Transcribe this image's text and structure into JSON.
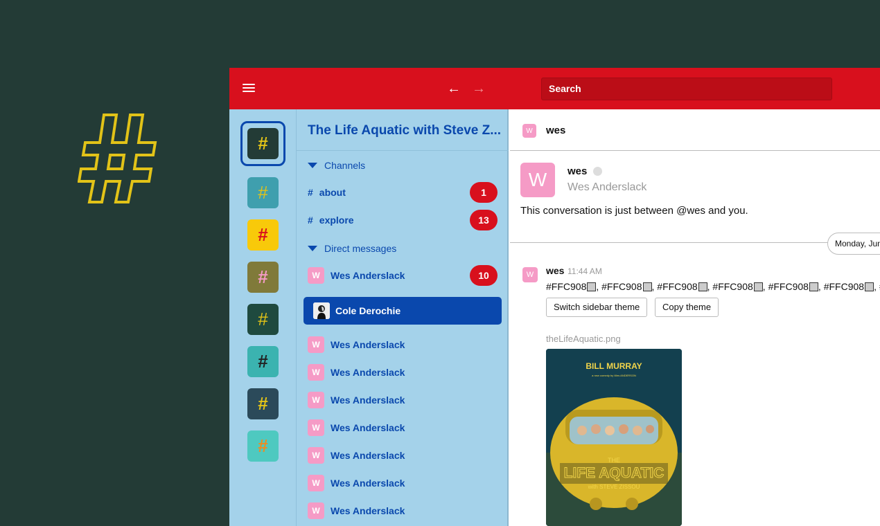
{
  "brand": {
    "logo_icon": "hash-icon",
    "logo_color": "#e2c318"
  },
  "topbar": {
    "menu_icon": "hamburger-icon",
    "back_icon": "arrow-left-icon",
    "forward_icon": "arrow-right-icon",
    "back_glyph": "←",
    "forward_glyph": "→",
    "search_label": "Search",
    "color": "#d8101d"
  },
  "workspaces": [
    {
      "name": "workspace-1",
      "icon": "hash-icon",
      "selected": true
    },
    {
      "name": "workspace-2",
      "icon": "hash-icon"
    },
    {
      "name": "workspace-3",
      "icon": "hash-icon"
    },
    {
      "name": "workspace-4",
      "icon": "hash-icon"
    },
    {
      "name": "workspace-5",
      "icon": "hash-icon"
    },
    {
      "name": "workspace-6",
      "icon": "hash-icon"
    },
    {
      "name": "workspace-7",
      "icon": "hash-icon"
    },
    {
      "name": "workspace-8",
      "icon": "hash-icon"
    }
  ],
  "sidebar": {
    "team_name": "The Life Aquatic with Steve Z...",
    "channels_header": "Channels",
    "channels": [
      {
        "hash": "#",
        "name": "about",
        "badge": "1"
      },
      {
        "hash": "#",
        "name": "explore",
        "badge": "13"
      }
    ],
    "dm_header": "Direct messages",
    "dms": [
      {
        "avatar": "W",
        "name": "Wes Anderslack",
        "badge": "10"
      },
      {
        "avatar": "",
        "name": "Cole Derochie",
        "active": true
      },
      {
        "avatar": "W",
        "name": "Wes Anderslack"
      },
      {
        "avatar": "W",
        "name": "Wes Anderslack"
      },
      {
        "avatar": "W",
        "name": "Wes Anderslack"
      },
      {
        "avatar": "W",
        "name": "Wes Anderslack"
      },
      {
        "avatar": "W",
        "name": "Wes Anderslack"
      },
      {
        "avatar": "W",
        "name": "Wes Anderslack"
      },
      {
        "avatar": "W",
        "name": "Wes Anderslack"
      }
    ]
  },
  "conversation": {
    "avatar": "W",
    "title": "wes",
    "intro": {
      "avatar": "W",
      "name": "wes",
      "full_name": "Wes Anderslack",
      "text": "This conversation is just between @wes and you."
    },
    "date_divider": "Monday, June",
    "message": {
      "avatar": "W",
      "author": "wes",
      "time": "11:44 AM",
      "color_token": "#FFC908",
      "buttons": [
        "Switch sidebar theme",
        "Copy theme"
      ],
      "file_name": "theLifeAquatic.png",
      "poster": {
        "top": "BILL MURRAY",
        "byline": "a new comedy by Wes ANDERSON",
        "title1": "THE",
        "title2": "LIFE AQUATIC",
        "subtitle": "with STEVE ZISSOU"
      }
    }
  }
}
